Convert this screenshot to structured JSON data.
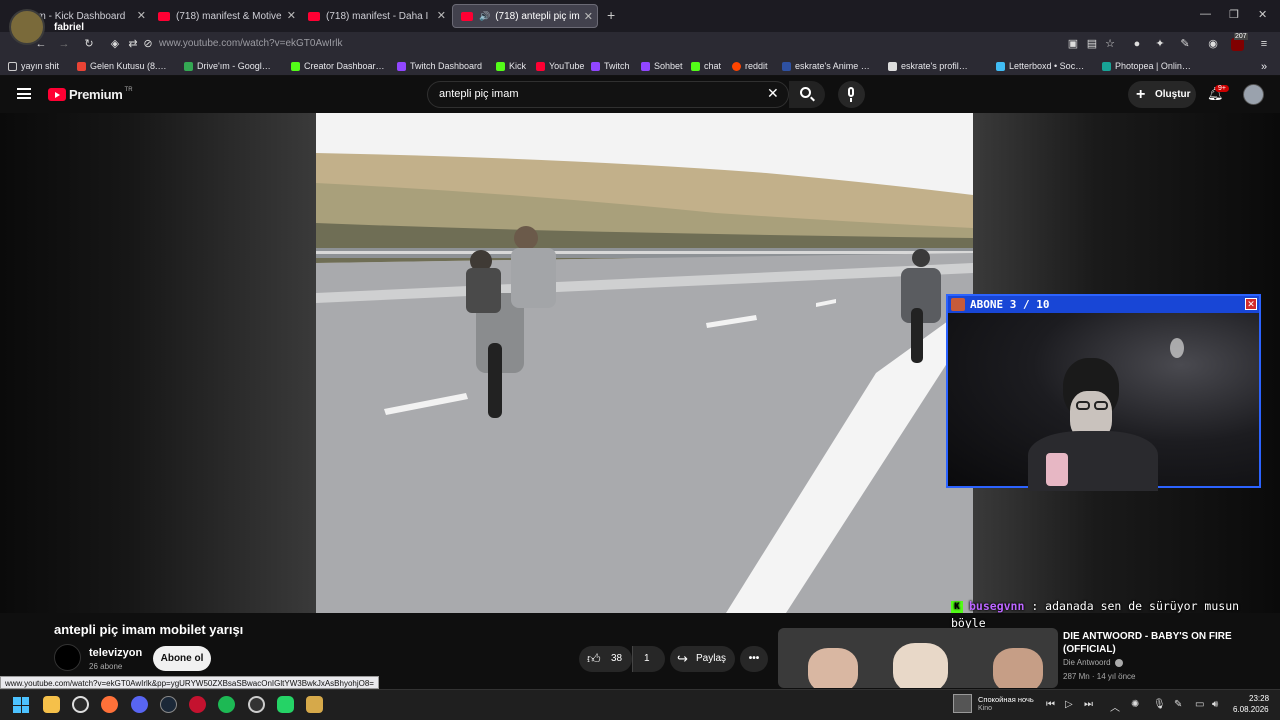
{
  "browser": {
    "profile_name": "fabriel",
    "tabs": [
      {
        "label": "am - Kick Dashboard"
      },
      {
        "label": "(718) manifest & Motive"
      },
      {
        "label": "(718) manifest - Daha I"
      },
      {
        "label": "(718) antepli piç im"
      }
    ],
    "url": "www.youtube.com/watch?v=ekGT0AwIrlk",
    "extension_badge": "207",
    "bookmarks": [
      {
        "label": "yayın shit",
        "color": "#888888"
      },
      {
        "label": "Gelen Kutusu (8.…",
        "color": "#ea4335"
      },
      {
        "label": "Drive'ım - Googl…",
        "color": "#34a853"
      },
      {
        "label": "Creator Dashboar…",
        "color": "#53fc18"
      },
      {
        "label": "Twitch Dashboard",
        "color": "#9146ff"
      },
      {
        "label": "Kick",
        "color": "#53fc18"
      },
      {
        "label": "YouTube",
        "color": "#ff0033"
      },
      {
        "label": "Twitch",
        "color": "#9146ff"
      },
      {
        "label": "Sohbet",
        "color": "#9146ff"
      },
      {
        "label": "chat",
        "color": "#53fc18"
      },
      {
        "label": "reddit",
        "color": "#ff4500"
      },
      {
        "label": "eskrate's Anime …",
        "color": "#2e51a2"
      },
      {
        "label": "eskrate's profil…",
        "color": "#dddddd"
      },
      {
        "label": "Letterboxd • Soc…",
        "color": "#40bcf4"
      },
      {
        "label": "Photopea | Onlin…",
        "color": "#18a497"
      }
    ]
  },
  "youtube": {
    "logo_text": "Premium",
    "logo_region": "TR",
    "search_value": "antepli piç imam",
    "create_label": "Oluştur",
    "notifications_badge": "9+"
  },
  "overlay": {
    "cam_title": "ABONE 3 / 10",
    "chat_user": "busegvnn",
    "chat_message": ": adanada sen de sürüyor musun böyle"
  },
  "video": {
    "title": "antepli piç imam mobilet yarışı",
    "channel": "televizyon",
    "subscribers": "26 abone",
    "subscribe_label": "Abone ol",
    "likes": "38",
    "dislikes": "1",
    "share_label": "Paylaş"
  },
  "recommendation": {
    "title": "DIE ANTWOORD - BABY'S ON FIRE (OFFICIAL)",
    "channel": "Die Antwoord",
    "meta": "287 Mn · 14 yıl önce"
  },
  "status_link": "www.youtube.com/watch?v=ekGT0AwIrlk&pp=ygURYW50ZXBsaSBwacOnIGltYW3BwkJxAsBhyohjO8=",
  "taskbar": {
    "media_title": "Спокойная ночь",
    "media_artist": "Kino",
    "time": "23:28",
    "date": "6.08.2026"
  },
  "colors": {
    "accent": "#ff0033",
    "kick_green": "#53fc18",
    "overlay_blue": "#1846d6",
    "chat_user": "#bb66ff"
  }
}
